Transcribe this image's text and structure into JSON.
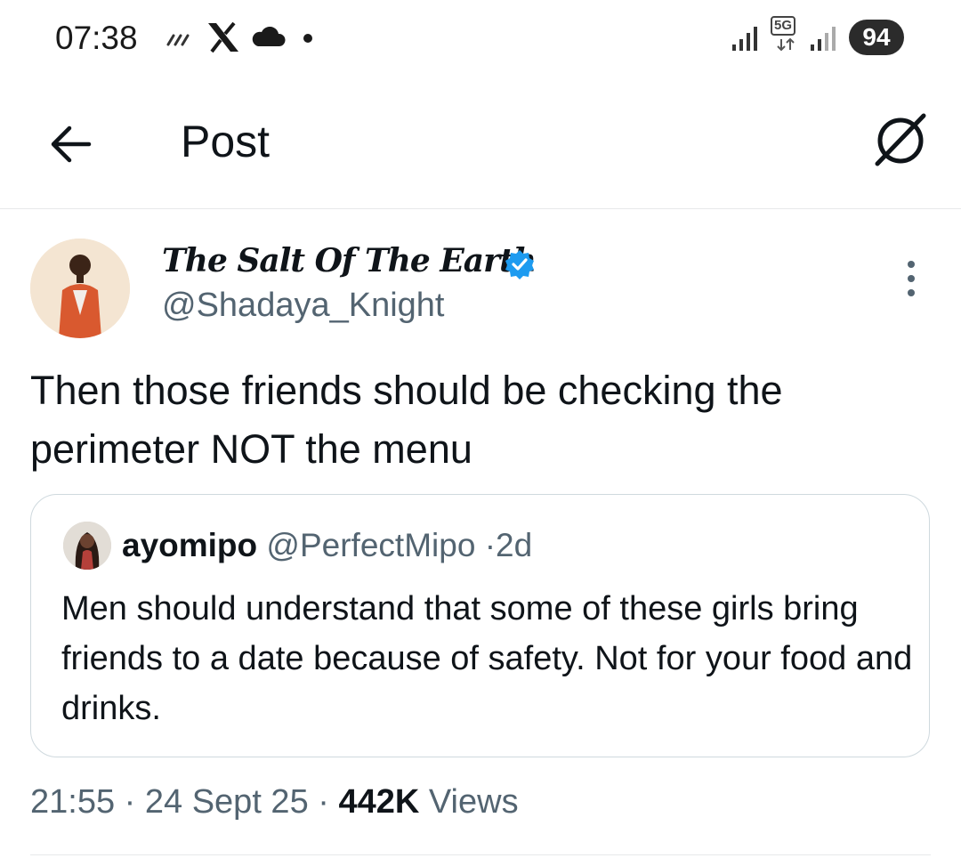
{
  "status_bar": {
    "time": "07:38",
    "network_type": "5G",
    "battery": "94",
    "icons": [
      "signal-waves-icon",
      "x-app-icon",
      "cloud-icon",
      "dot-icon",
      "cell-signal-icon",
      "5g-icon",
      "cell-signal-icon",
      "battery-icon"
    ]
  },
  "header": {
    "title": "Post",
    "back_icon": "arrow-left-icon",
    "grok_icon": "grok-icon"
  },
  "post": {
    "author_name": "The Salt Of The Earth",
    "author_handle": "@Shadaya_Knight",
    "verified": true,
    "text": "Then those friends should be checking the perimeter NOT the menu",
    "timestamp": "21:55",
    "date": "24 Sept 25",
    "views_count": "442K",
    "views_label": "Views",
    "separator": "·"
  },
  "quote": {
    "author_name": "ayomipo",
    "author_handle": "@PerfectMipo",
    "age": "2d",
    "separator": "·",
    "text": "Men should understand that some of these girls bring friends to a date because of safety. Not for your food and drinks."
  },
  "colors": {
    "text_primary": "#0f1419",
    "text_secondary": "#536471",
    "verified_blue": "#1d9bf0",
    "border": "#cfd9de"
  }
}
